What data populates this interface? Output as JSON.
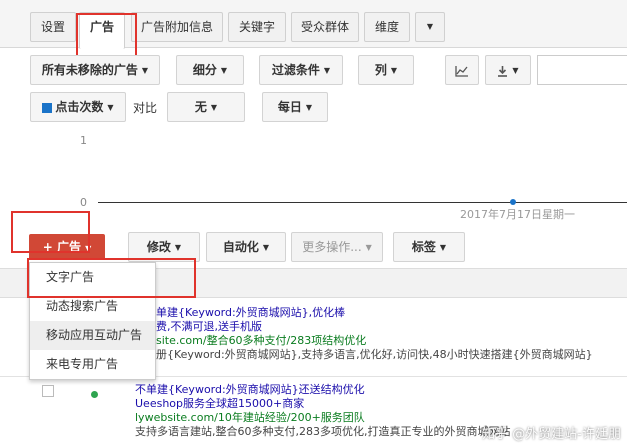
{
  "tabs": [
    "设置",
    "广告",
    "广告附加信息",
    "关键字",
    "受众群体",
    "维度"
  ],
  "tabs_more_caret": "▼",
  "toolbar": {
    "status_filter": "所有未移除的广告",
    "segment": "细分",
    "filter": "过滤条件",
    "columns": "列",
    "chart_icon": "line-chart-icon",
    "download_icon": "download-icon",
    "caret": "▼"
  },
  "chart_controls": {
    "metric": "点击次数",
    "metric_color": "#1a73c8",
    "compare_label": "对比",
    "compare_value": "无",
    "period": "每日"
  },
  "chart_data": {
    "type": "line",
    "x": [
      "2017年7月17日星期一"
    ],
    "series": [
      {
        "name": "点击次数",
        "values": [
          0
        ]
      }
    ],
    "ylim": [
      0,
      1
    ],
    "yticks": [
      "1",
      "0"
    ],
    "grid": false
  },
  "chart_label": "2017年7月17日星期一",
  "actions": {
    "add_ad": "广告",
    "add_ad_plus": "+",
    "edit": "修改",
    "automate": "自动化",
    "more": "更多操作...",
    "labels": "标签",
    "caret": "▼"
  },
  "ad_menu": [
    "文字广告",
    "动态搜索广告",
    "移动应用互动广告",
    "来电专用广告"
  ],
  "ads": [
    {
      "title": "单建{Keyword:外贸商城网站},优化棒",
      "title2": "费,不满可退,送手机版",
      "url": "site.com/整合60多种支付/283项结构优化",
      "desc": "册{Keyword:外贸商城网站},支持多语言,优化好,访问快,48小时快速搭建{外贸商城网站}"
    },
    {
      "title": "不单建{Keyword:外贸商城网站}还送结构优化",
      "title2": "Ueeshop服务全球超15000+商家",
      "url": "lywebsite.com/10年建站经验/200+服务团队",
      "desc": "支持多语言建站,整合60多种支付,283多项优化,打造真正专业的外贸商城网站"
    }
  ],
  "watermark": "知乎 @外贸建站-许廷朋"
}
